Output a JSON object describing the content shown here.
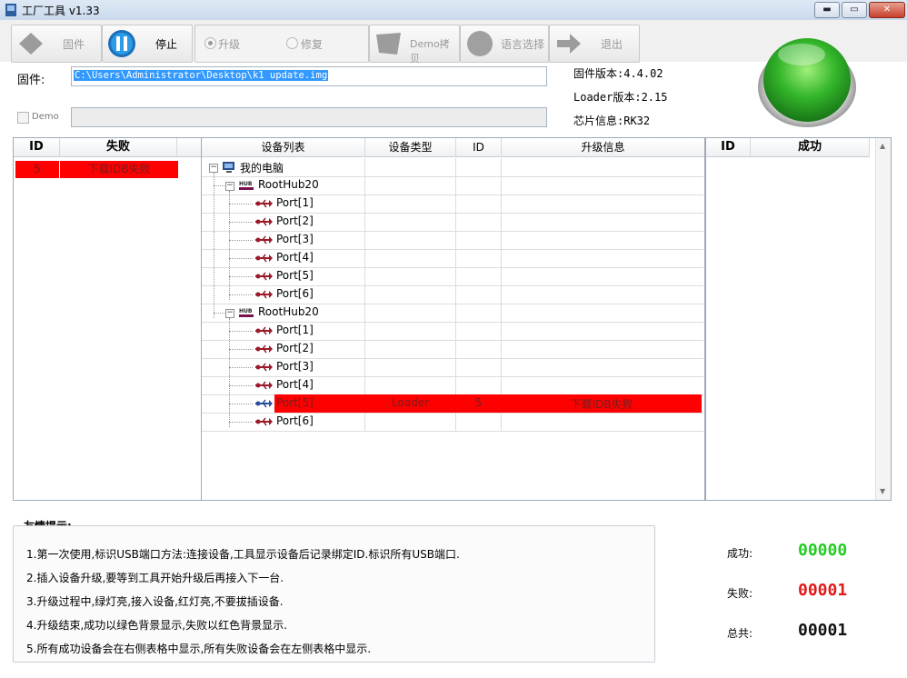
{
  "window": {
    "title": "工厂工具 v1.33",
    "minimize": "▬",
    "maximize": "▭",
    "close": "✕"
  },
  "toolbar": {
    "firmware_label": "固件",
    "stop_label": "停止",
    "upgrade_label": "升级",
    "repair_label": "修复",
    "demo_copy_label": "Demo拷贝",
    "language_label": "语言选择",
    "exit_label": "退出"
  },
  "firmware": {
    "label": "固件:",
    "path": "C:\\Users\\Administrator\\Desktop\\k1  update.img"
  },
  "demo": {
    "label": "Demo",
    "path": ""
  },
  "chip_info": {
    "fw_version": "固件版本:4.4.02",
    "loader_version": "Loader版本:2.15",
    "chip": "芯片信息:RK32"
  },
  "status_light": {
    "color": "#2fbf2f"
  },
  "fail_table": {
    "headers": [
      "ID",
      "失败"
    ],
    "rows": [
      {
        "id": "5",
        "status": "下载IDB失败"
      }
    ]
  },
  "device_table": {
    "headers": [
      "设备列表",
      "设备类型",
      "ID",
      "升级信息"
    ],
    "root": "我的电脑",
    "hubs": [
      {
        "label": "RootHub20",
        "ports": [
          {
            "label": "Port[1]",
            "type": "",
            "id": "",
            "info": "",
            "error": false
          },
          {
            "label": "Port[2]",
            "type": "",
            "id": "",
            "info": "",
            "error": false
          },
          {
            "label": "Port[3]",
            "type": "",
            "id": "",
            "info": "",
            "error": false
          },
          {
            "label": "Port[4]",
            "type": "",
            "id": "",
            "info": "",
            "error": false
          },
          {
            "label": "Port[5]",
            "type": "",
            "id": "",
            "info": "",
            "error": false
          },
          {
            "label": "Port[6]",
            "type": "",
            "id": "",
            "info": "",
            "error": false
          }
        ]
      },
      {
        "label": "RootHub20",
        "ports": [
          {
            "label": "Port[1]",
            "type": "",
            "id": "",
            "info": "",
            "error": false
          },
          {
            "label": "Port[2]",
            "type": "",
            "id": "",
            "info": "",
            "error": false
          },
          {
            "label": "Port[3]",
            "type": "",
            "id": "",
            "info": "",
            "error": false
          },
          {
            "label": "Port[4]",
            "type": "",
            "id": "",
            "info": "",
            "error": false
          },
          {
            "label": "Port[5]",
            "type": "Loader",
            "id": "5",
            "info": "下载IDB失败",
            "error": true
          },
          {
            "label": "Port[6]",
            "type": "",
            "id": "",
            "info": "",
            "error": false
          }
        ]
      }
    ]
  },
  "success_table": {
    "headers": [
      "ID",
      "成功"
    ],
    "rows": []
  },
  "tips": {
    "title": "友情提示:",
    "items": [
      "1.第一次使用,标识USB端口方法:连接设备,工具显示设备后记录绑定ID.标识所有USB端口.",
      "2.插入设备升级,要等到工具开始升级后再接入下一台.",
      "3.升级过程中,绿灯亮,接入设备,红灯亮,不要拔插设备.",
      "4.升级结束,成功以绿色背景显示,失败以红色背景显示.",
      "5.所有成功设备会在右侧表格中显示,所有失败设备会在左侧表格中显示."
    ]
  },
  "stats": {
    "success_label": "成功:",
    "success_value": "00000",
    "success_color": "#22cc22",
    "fail_label": "失败:",
    "fail_value": "00001",
    "fail_color": "#e01818",
    "total_label": "总共:",
    "total_value": "00001",
    "total_color": "#111111"
  },
  "colors": {
    "error_row": "#ff0000",
    "selection": "#3399ff"
  },
  "icons": [
    "app-icon",
    "firmware-icon",
    "pause-icon",
    "demo-copy-icon",
    "language-icon",
    "exit-arrow-icon",
    "computer-icon",
    "hub-icon",
    "usb-port-icon"
  ]
}
